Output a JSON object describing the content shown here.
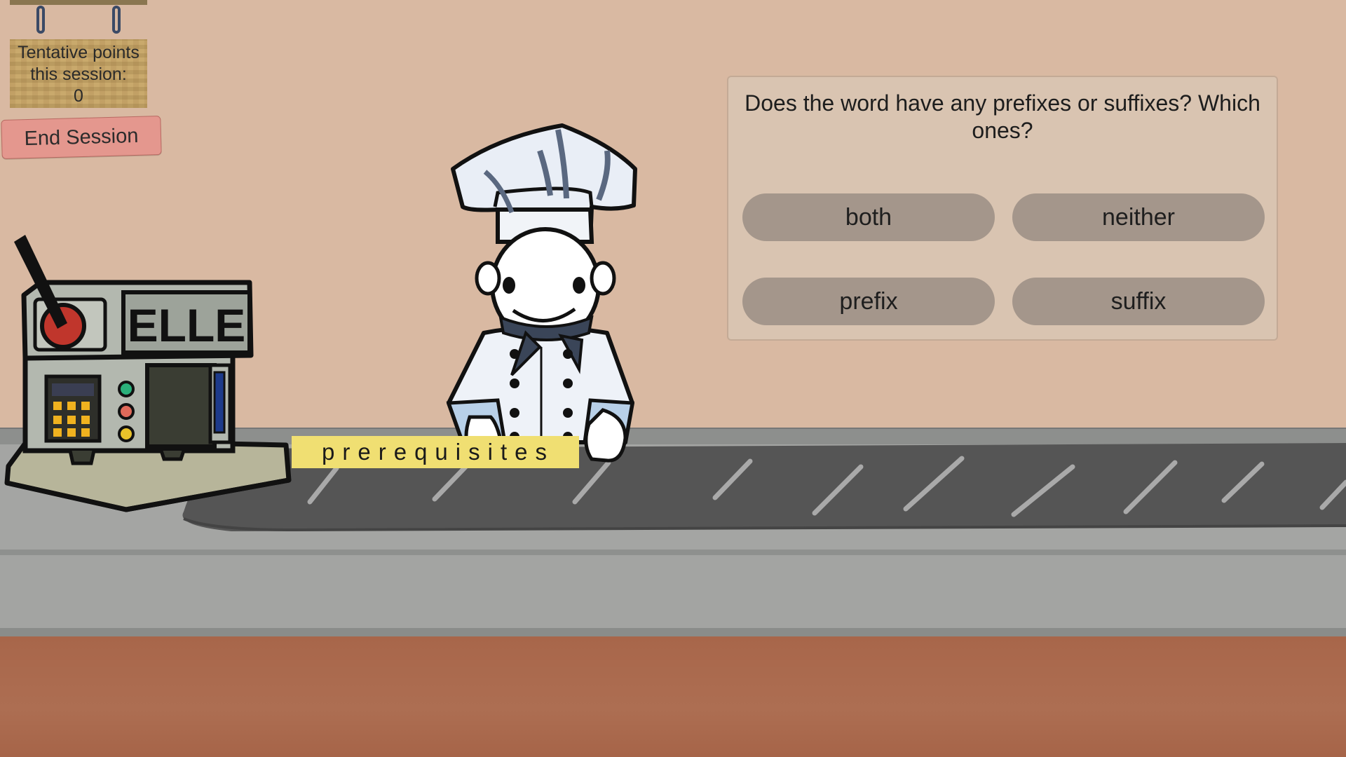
{
  "points_sign": {
    "line1": "Tentative points",
    "line2": "this session:",
    "value": "0"
  },
  "end_session": {
    "label": "End Session"
  },
  "question": {
    "text": "Does the word have any prefixes or suffixes? Which ones?",
    "answers": [
      "both",
      "neither",
      "prefix",
      "suffix"
    ]
  },
  "word": {
    "text": "prerequisites"
  },
  "machine": {
    "brand": "ELLE"
  },
  "colors": {
    "wall": "#d9b9a2",
    "panel": "#d9c4b1",
    "answer_button": "#a4968b",
    "end_session_button": "#e4978e",
    "word_label": "#f0df72",
    "floor": "#a8664a"
  }
}
